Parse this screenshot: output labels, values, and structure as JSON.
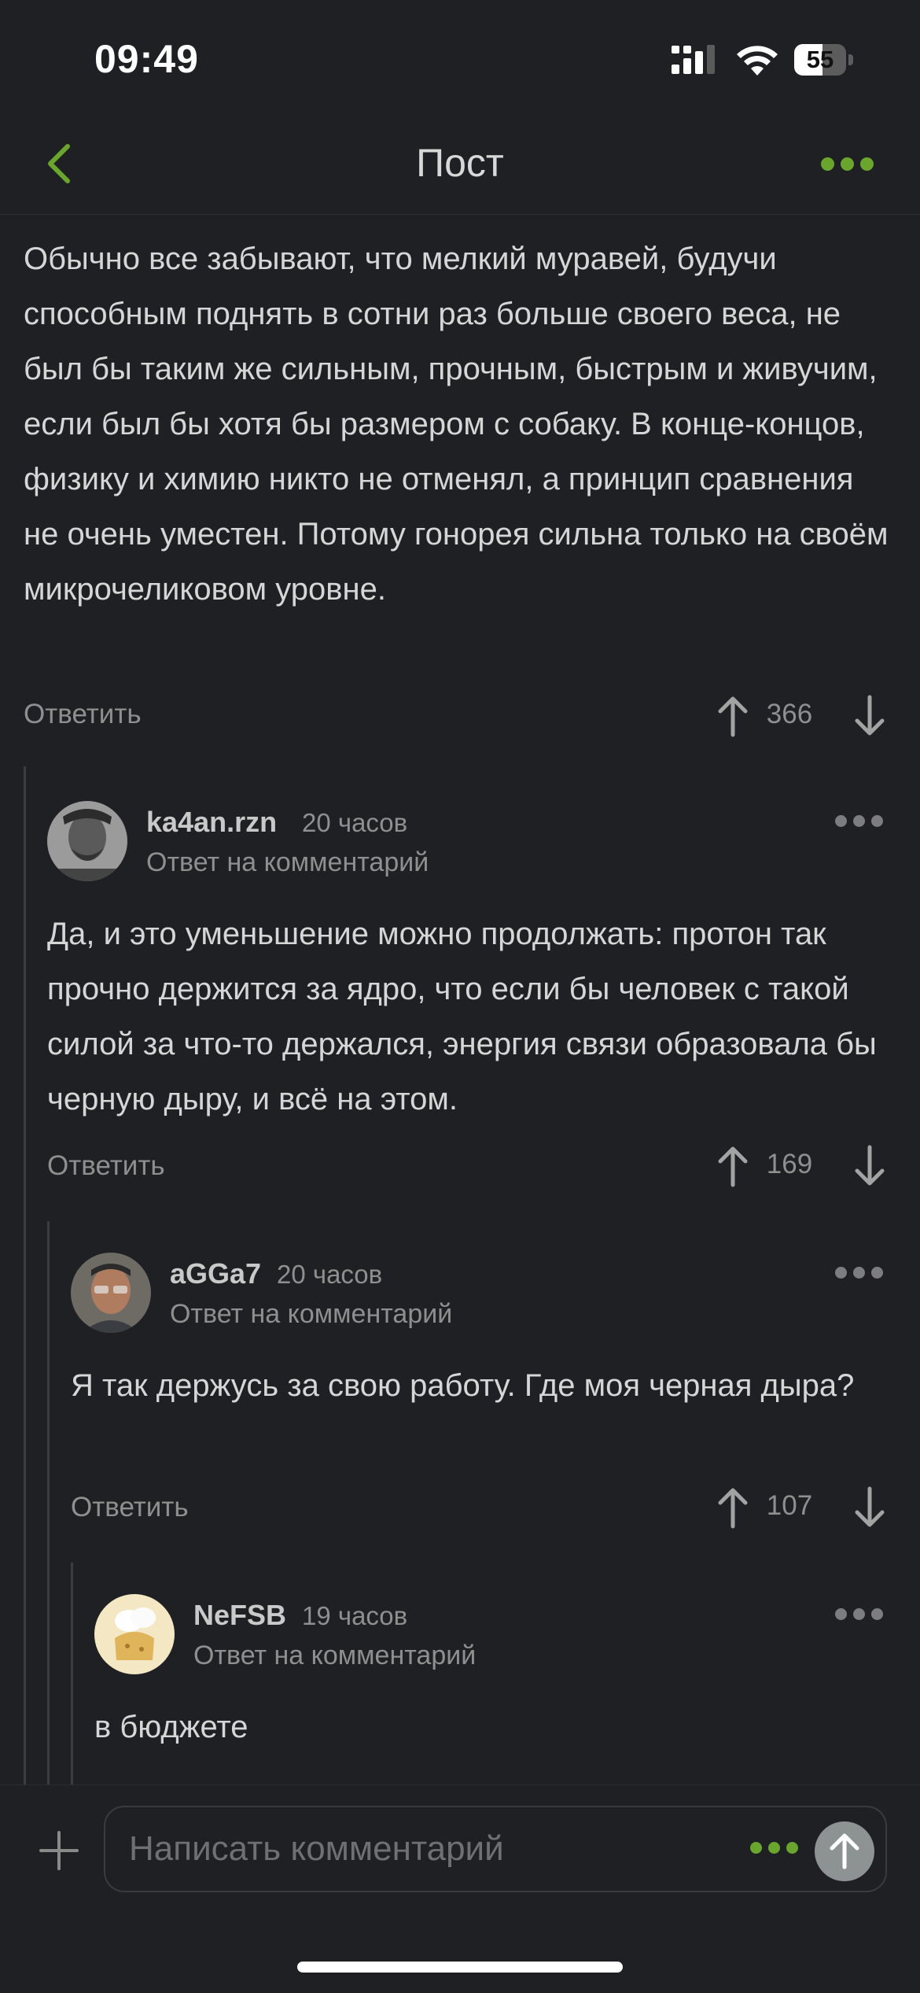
{
  "status_bar": {
    "time": "09:49",
    "battery": "55",
    "battery_level": 0.55
  },
  "header": {
    "title": "Пост"
  },
  "comments": [
    {
      "text": "Обычно все забывают, что мелкий муравей, будучи способным поднять в сотни раз больше своего веса, не был бы таким же сильным, прочным, быстрым и живучим, если был бы хотя бы размером с собаку. В конце-концов, физику и химию никто не отменял, а принцип сравнения не очень уместен. Потому гонорея сильна только на своём микрочеликовом уровне.",
      "reply_label": "Ответить",
      "votes": "366"
    },
    {
      "username": "ka4an.rzn",
      "time": "20 часов",
      "reply_to": "Ответ на комментарий",
      "text": "Да, и это уменьшение можно продолжать: протон так прочно держится за ядро, что если бы человек с такой силой за что-то держался, энергия связи образовала бы черную дыру, и всё на этом.",
      "reply_label": "Ответить",
      "votes": "169"
    },
    {
      "username": "aGGa7",
      "time": "20 часов",
      "reply_to": "Ответ на комментарий",
      "text": "Я так держусь за свою работу. Где моя черная дыра?",
      "reply_label": "Ответить",
      "votes": "107"
    },
    {
      "username": "NeFSB",
      "time": "19 часов",
      "reply_to": "Ответ на комментарий",
      "text": "в бюджете"
    }
  ],
  "composer": {
    "placeholder": "Написать комментарий"
  },
  "colors": {
    "accent": "#6aa62e",
    "background": "#1f2023",
    "muted": "#8f8f8f"
  }
}
